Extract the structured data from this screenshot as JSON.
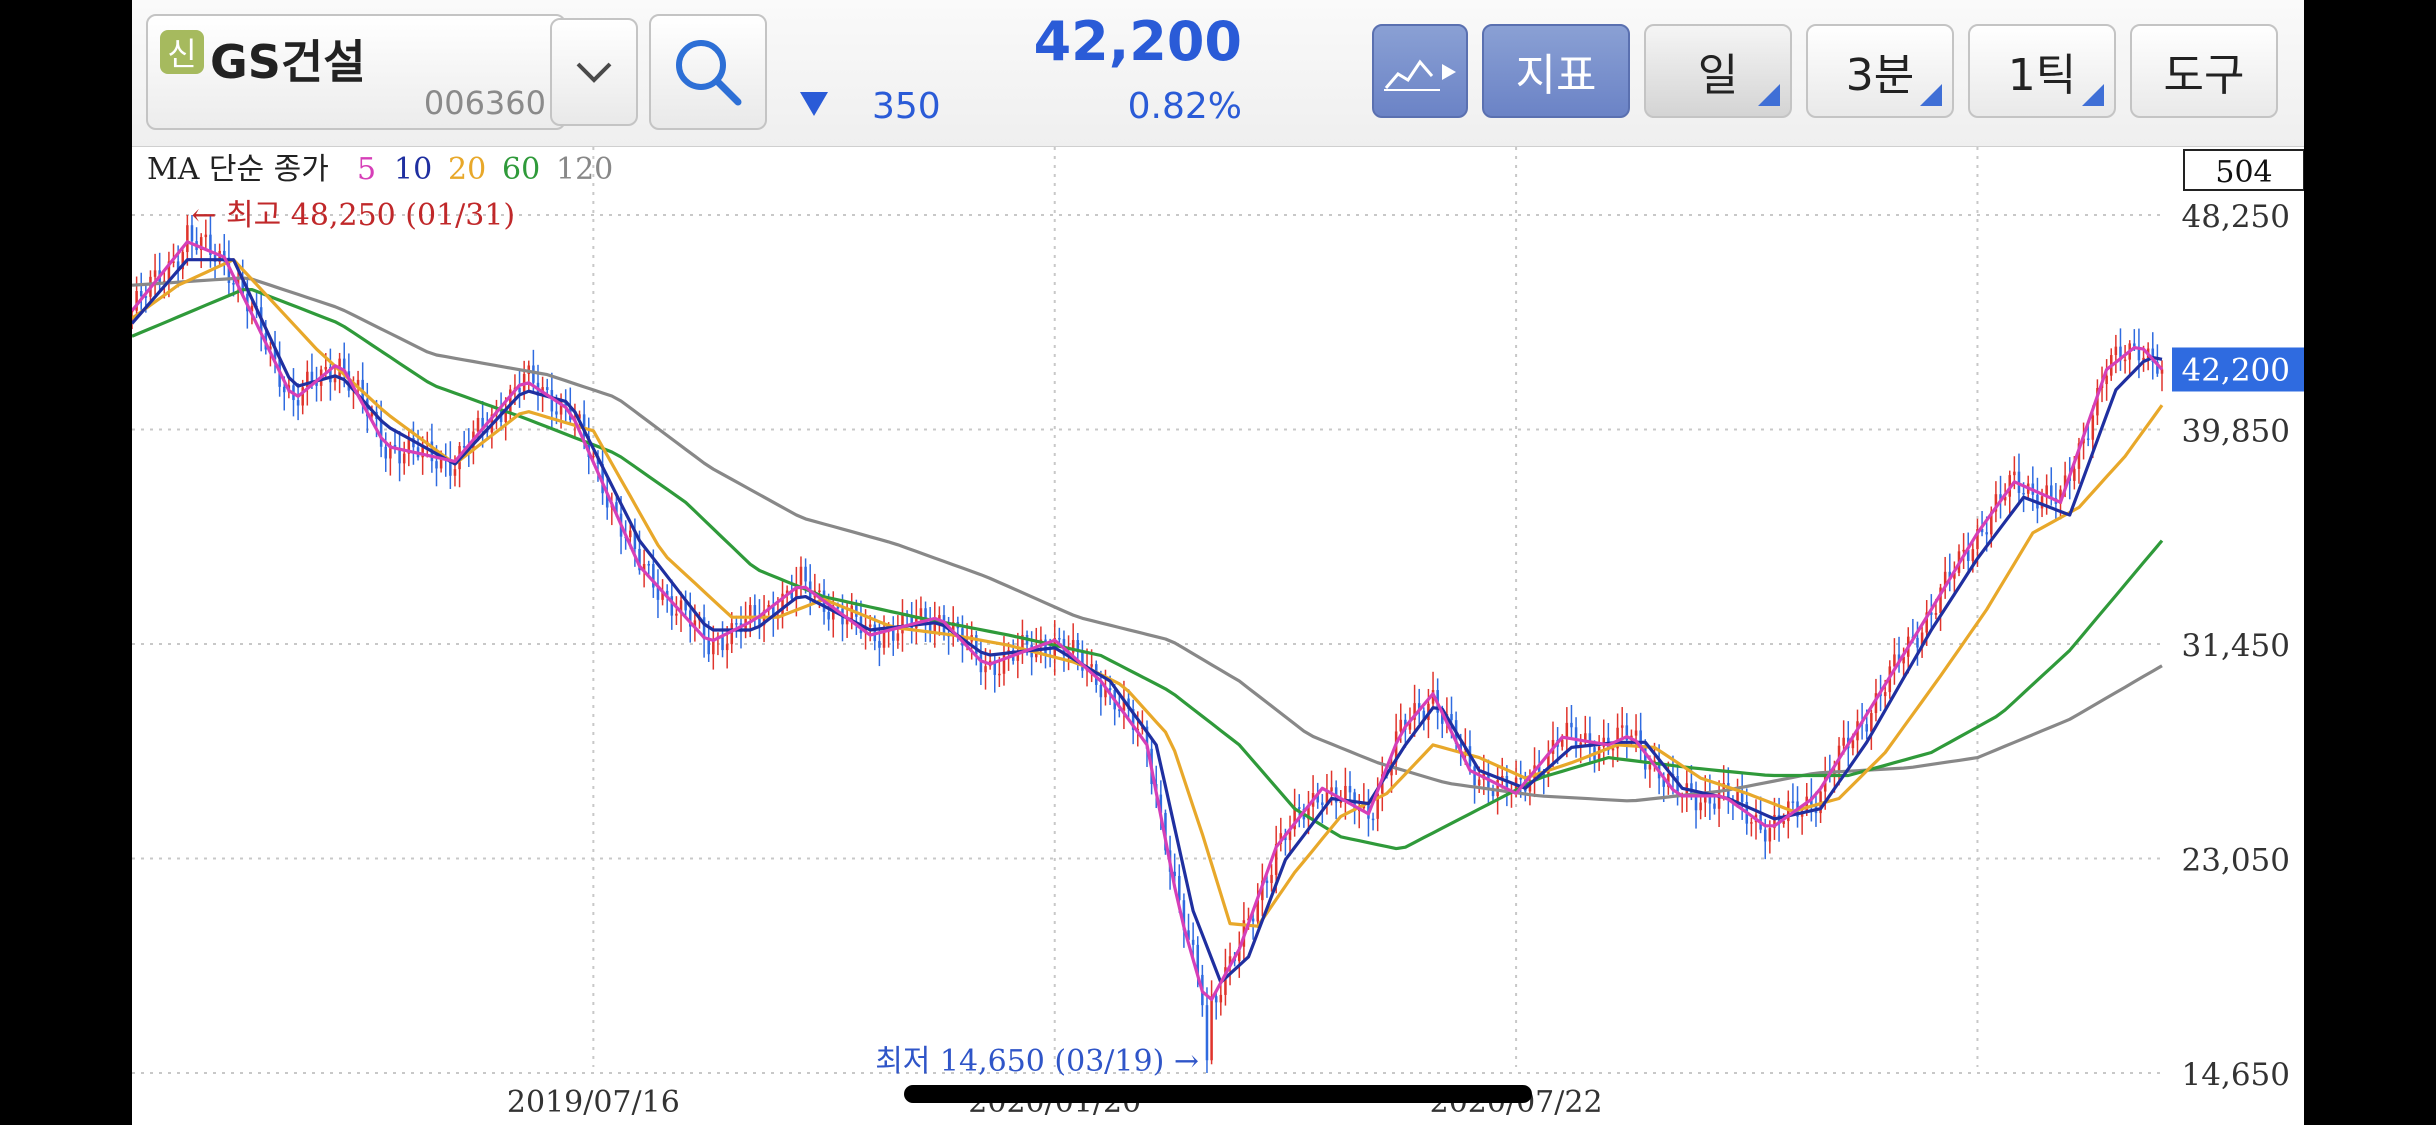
{
  "toolbar": {
    "badge": "신",
    "stock_name": "GS건설",
    "stock_code": "006360",
    "price": "42,200",
    "change": "350",
    "change_rate": "0.82%",
    "buttons": {
      "indicator": "지표",
      "period": "일",
      "interval": "3분",
      "tick": "1틱",
      "tools": "도구"
    }
  },
  "chart_data": {
    "type": "candlestick",
    "legend": {
      "prefix": "MA 단순 종가",
      "periods": [
        {
          "label": "5",
          "color": "#d63fb8"
        },
        {
          "label": "10",
          "color": "#1f2fa0"
        },
        {
          "label": "20",
          "color": "#e8a82a"
        },
        {
          "label": "60",
          "color": "#2f9a3a"
        },
        {
          "label": "120",
          "color": "#888888"
        }
      ]
    },
    "y_ticks": [
      "48,250",
      "39,850",
      "31,450",
      "23,050",
      "14,650"
    ],
    "y_tick_values": [
      48250,
      39850,
      31450,
      23050,
      14650
    ],
    "ylim": [
      14650,
      48250
    ],
    "x_ticks": [
      "2019/07/16",
      "2020/01/20",
      "2020/07/22"
    ],
    "x_tick_index": [
      100,
      200,
      300
    ],
    "top_label": "504",
    "current_price_label": "42,200",
    "current_price": 42200,
    "annotations": {
      "high": {
        "text": "← 최고 48,250 (01/31)",
        "value": 48250,
        "index": 12
      },
      "low": {
        "text": "최저 14,650 (03/19) →",
        "value": 14650,
        "index": 233
      }
    },
    "series_ma": [
      {
        "name": "MA5",
        "color": "#d63fb8",
        "keypoints": [
          [
            0,
            44500
          ],
          [
            12,
            47200
          ],
          [
            20,
            46600
          ],
          [
            35,
            41000
          ],
          [
            45,
            42500
          ],
          [
            55,
            39200
          ],
          [
            70,
            38600
          ],
          [
            85,
            41800
          ],
          [
            95,
            40600
          ],
          [
            110,
            34500
          ],
          [
            125,
            31500
          ],
          [
            135,
            32400
          ],
          [
            145,
            33800
          ],
          [
            160,
            31800
          ],
          [
            175,
            32500
          ],
          [
            185,
            30600
          ],
          [
            200,
            31600
          ],
          [
            210,
            30000
          ],
          [
            220,
            27500
          ],
          [
            227,
            21000
          ],
          [
            233,
            17200
          ],
          [
            240,
            19500
          ],
          [
            248,
            23500
          ],
          [
            258,
            25800
          ],
          [
            268,
            24800
          ],
          [
            275,
            28000
          ],
          [
            282,
            29500
          ],
          [
            290,
            26500
          ],
          [
            300,
            25600
          ],
          [
            310,
            27800
          ],
          [
            320,
            27500
          ],
          [
            325,
            27900
          ],
          [
            335,
            25500
          ],
          [
            345,
            25500
          ],
          [
            355,
            24200
          ],
          [
            365,
            25500
          ],
          [
            375,
            28400
          ],
          [
            390,
            32800
          ],
          [
            400,
            35800
          ],
          [
            408,
            37800
          ],
          [
            418,
            37000
          ],
          [
            428,
            42200
          ],
          [
            435,
            43200
          ],
          [
            440,
            42200
          ]
        ]
      },
      {
        "name": "MA10",
        "color": "#1f2fa0",
        "keypoints": [
          [
            0,
            44000
          ],
          [
            12,
            46500
          ],
          [
            22,
            46500
          ],
          [
            35,
            41500
          ],
          [
            45,
            42000
          ],
          [
            55,
            40000
          ],
          [
            70,
            38500
          ],
          [
            85,
            41400
          ],
          [
            95,
            40900
          ],
          [
            110,
            35500
          ],
          [
            125,
            32000
          ],
          [
            135,
            32000
          ],
          [
            145,
            33400
          ],
          [
            160,
            32000
          ],
          [
            175,
            32300
          ],
          [
            185,
            31000
          ],
          [
            200,
            31300
          ],
          [
            212,
            30000
          ],
          [
            222,
            27500
          ],
          [
            230,
            21000
          ],
          [
            236,
            18200
          ],
          [
            242,
            19200
          ],
          [
            250,
            23000
          ],
          [
            260,
            25400
          ],
          [
            268,
            25200
          ],
          [
            276,
            27500
          ],
          [
            283,
            29200
          ],
          [
            292,
            26500
          ],
          [
            302,
            25800
          ],
          [
            312,
            27400
          ],
          [
            322,
            27600
          ],
          [
            328,
            27600
          ],
          [
            336,
            25800
          ],
          [
            346,
            25400
          ],
          [
            356,
            24600
          ],
          [
            366,
            25000
          ],
          [
            376,
            27600
          ],
          [
            390,
            32000
          ],
          [
            400,
            34800
          ],
          [
            410,
            37200
          ],
          [
            420,
            36500
          ],
          [
            430,
            41400
          ],
          [
            437,
            42700
          ],
          [
            440,
            42600
          ]
        ]
      },
      {
        "name": "MA20",
        "color": "#e8a82a",
        "keypoints": [
          [
            0,
            44200
          ],
          [
            10,
            45500
          ],
          [
            22,
            46500
          ],
          [
            40,
            43000
          ],
          [
            55,
            40500
          ],
          [
            70,
            38500
          ],
          [
            85,
            40600
          ],
          [
            100,
            39800
          ],
          [
            115,
            35000
          ],
          [
            130,
            32500
          ],
          [
            140,
            32500
          ],
          [
            150,
            33200
          ],
          [
            165,
            32100
          ],
          [
            178,
            31800
          ],
          [
            190,
            31400
          ],
          [
            205,
            30700
          ],
          [
            215,
            29800
          ],
          [
            225,
            27800
          ],
          [
            232,
            24000
          ],
          [
            238,
            20500
          ],
          [
            244,
            20400
          ],
          [
            252,
            22500
          ],
          [
            262,
            24700
          ],
          [
            272,
            25600
          ],
          [
            282,
            27500
          ],
          [
            292,
            27000
          ],
          [
            302,
            26200
          ],
          [
            312,
            26800
          ],
          [
            322,
            27500
          ],
          [
            330,
            27400
          ],
          [
            340,
            26200
          ],
          [
            350,
            25600
          ],
          [
            360,
            24900
          ],
          [
            370,
            25400
          ],
          [
            380,
            27200
          ],
          [
            392,
            30200
          ],
          [
            402,
            32800
          ],
          [
            412,
            35800
          ],
          [
            422,
            36800
          ],
          [
            432,
            38800
          ],
          [
            440,
            40800
          ]
        ]
      },
      {
        "name": "MA60",
        "color": "#2f9a3a",
        "keypoints": [
          [
            0,
            43500
          ],
          [
            25,
            45400
          ],
          [
            45,
            44000
          ],
          [
            65,
            41600
          ],
          [
            85,
            40300
          ],
          [
            105,
            38900
          ],
          [
            120,
            37000
          ],
          [
            135,
            34400
          ],
          [
            150,
            33300
          ],
          [
            170,
            32500
          ],
          [
            190,
            31800
          ],
          [
            210,
            31000
          ],
          [
            225,
            29600
          ],
          [
            240,
            27500
          ],
          [
            252,
            25000
          ],
          [
            262,
            23900
          ],
          [
            275,
            23400
          ],
          [
            290,
            24800
          ],
          [
            305,
            26200
          ],
          [
            320,
            27000
          ],
          [
            338,
            26600
          ],
          [
            355,
            26300
          ],
          [
            372,
            26300
          ],
          [
            390,
            27200
          ],
          [
            405,
            28700
          ],
          [
            420,
            31200
          ],
          [
            440,
            35500
          ]
        ]
      },
      {
        "name": "MA120",
        "color": "#888888",
        "keypoints": [
          [
            0,
            45500
          ],
          [
            25,
            45800
          ],
          [
            45,
            44600
          ],
          [
            65,
            42800
          ],
          [
            90,
            42000
          ],
          [
            105,
            41100
          ],
          [
            125,
            38400
          ],
          [
            145,
            36400
          ],
          [
            165,
            35400
          ],
          [
            185,
            34100
          ],
          [
            205,
            32500
          ],
          [
            225,
            31600
          ],
          [
            240,
            30000
          ],
          [
            255,
            27900
          ],
          [
            270,
            26800
          ],
          [
            285,
            26000
          ],
          [
            305,
            25500
          ],
          [
            325,
            25300
          ],
          [
            345,
            25700
          ],
          [
            365,
            26400
          ],
          [
            385,
            26600
          ],
          [
            400,
            27000
          ],
          [
            420,
            28500
          ],
          [
            440,
            30600
          ]
        ]
      }
    ]
  }
}
